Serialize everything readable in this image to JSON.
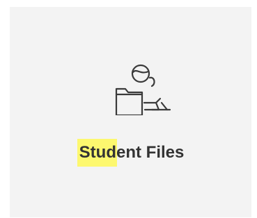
{
  "tile": {
    "title_highlighted": "Stud",
    "title_rest": "ent Files",
    "icon": "student-files-icon",
    "highlight_color": "#fdf86f"
  }
}
